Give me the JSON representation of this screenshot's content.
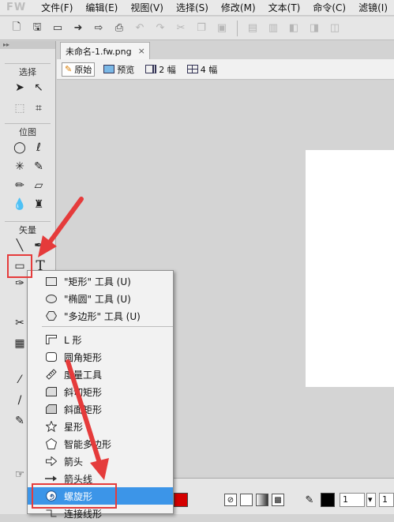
{
  "app": {
    "logo": "FW"
  },
  "menubar": {
    "items": [
      "文件(F)",
      "编辑(E)",
      "视图(V)",
      "选择(S)",
      "修改(M)",
      "文本(T)",
      "命令(C)",
      "滤镜(I)"
    ]
  },
  "tools": {
    "sections": {
      "select": "选择",
      "bitmap": "位图",
      "vector": "矢量"
    },
    "text_tool": "T"
  },
  "document": {
    "tab_title": "未命名-1.fw.png",
    "close": "×"
  },
  "viewbar": {
    "original": "原始",
    "preview": "预览",
    "two_up": "2 幅",
    "four_up": "4 幅"
  },
  "propbar": {
    "stroke_width": "1",
    "field2": "1"
  },
  "shape_menu": {
    "items": [
      {
        "label": "\"矩形\" 工具 (U)"
      },
      {
        "label": "\"椭圆\" 工具 (U)"
      },
      {
        "label": "\"多边形\" 工具 (U)"
      },
      {
        "label": "L 形"
      },
      {
        "label": "圆角矩形"
      },
      {
        "label": "度量工具"
      },
      {
        "label": "斜切矩形"
      },
      {
        "label": "斜面矩形"
      },
      {
        "label": "星形"
      },
      {
        "label": "智能多边形"
      },
      {
        "label": "箭头"
      },
      {
        "label": "箭头线"
      },
      {
        "label": "螺旋形"
      },
      {
        "label": "连接线形"
      }
    ],
    "selected": "螺旋形"
  },
  "colors": {
    "annotation_red": "#e53b3b",
    "menu_highlight": "#3c95e8",
    "fill_swatch": "#d40000"
  }
}
